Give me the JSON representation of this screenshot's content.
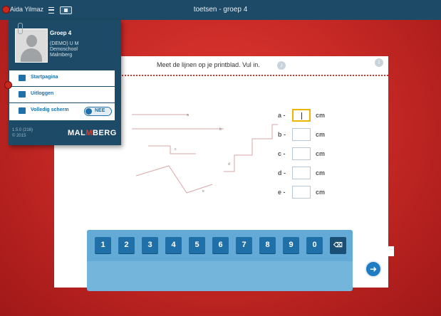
{
  "topbar": {
    "user_name": "Aida Yilmaz",
    "title": "toetsen - groep 4",
    "menu_icon": "hamburger-icon",
    "screen_icon": "screen-icon"
  },
  "panel": {
    "group": "Groep 4",
    "class_name": "(DEMO) U M",
    "school": "Demoschool",
    "publisher": "Malmberg",
    "menu": {
      "home_label": "Startpagina",
      "logout_label": "Uitloggen",
      "fullscreen_label": "Volledig scherm",
      "fullscreen_toggle": "NEE"
    },
    "version": "1.5.0 (216)",
    "copyright": "© 2015",
    "logo_pre": "MAL",
    "logo_o": "M",
    "logo_post": "BERG"
  },
  "exercise": {
    "instruction": "Meet de lijnen op je printblad. Vul in.",
    "line_labels": [
      "a",
      "b",
      "c",
      "d",
      "e"
    ],
    "answers": [
      {
        "label": "a -",
        "value": "",
        "unit": "cm"
      },
      {
        "label": "b -",
        "value": "",
        "unit": "cm"
      },
      {
        "label": "c -",
        "value": "",
        "unit": "cm"
      },
      {
        "label": "d -",
        "value": "",
        "unit": "cm"
      },
      {
        "label": "e -",
        "value": "",
        "unit": "cm"
      }
    ]
  },
  "keypad": {
    "keys": [
      "1",
      "2",
      "3",
      "4",
      "5",
      "6",
      "7",
      "8",
      "9",
      "0"
    ],
    "backspace_glyph": "⌫"
  },
  "next_glyph": "➜",
  "colors": {
    "topbar": "#1d4a66",
    "accent": "#1f6fa8",
    "background_red": "#c92a26"
  }
}
